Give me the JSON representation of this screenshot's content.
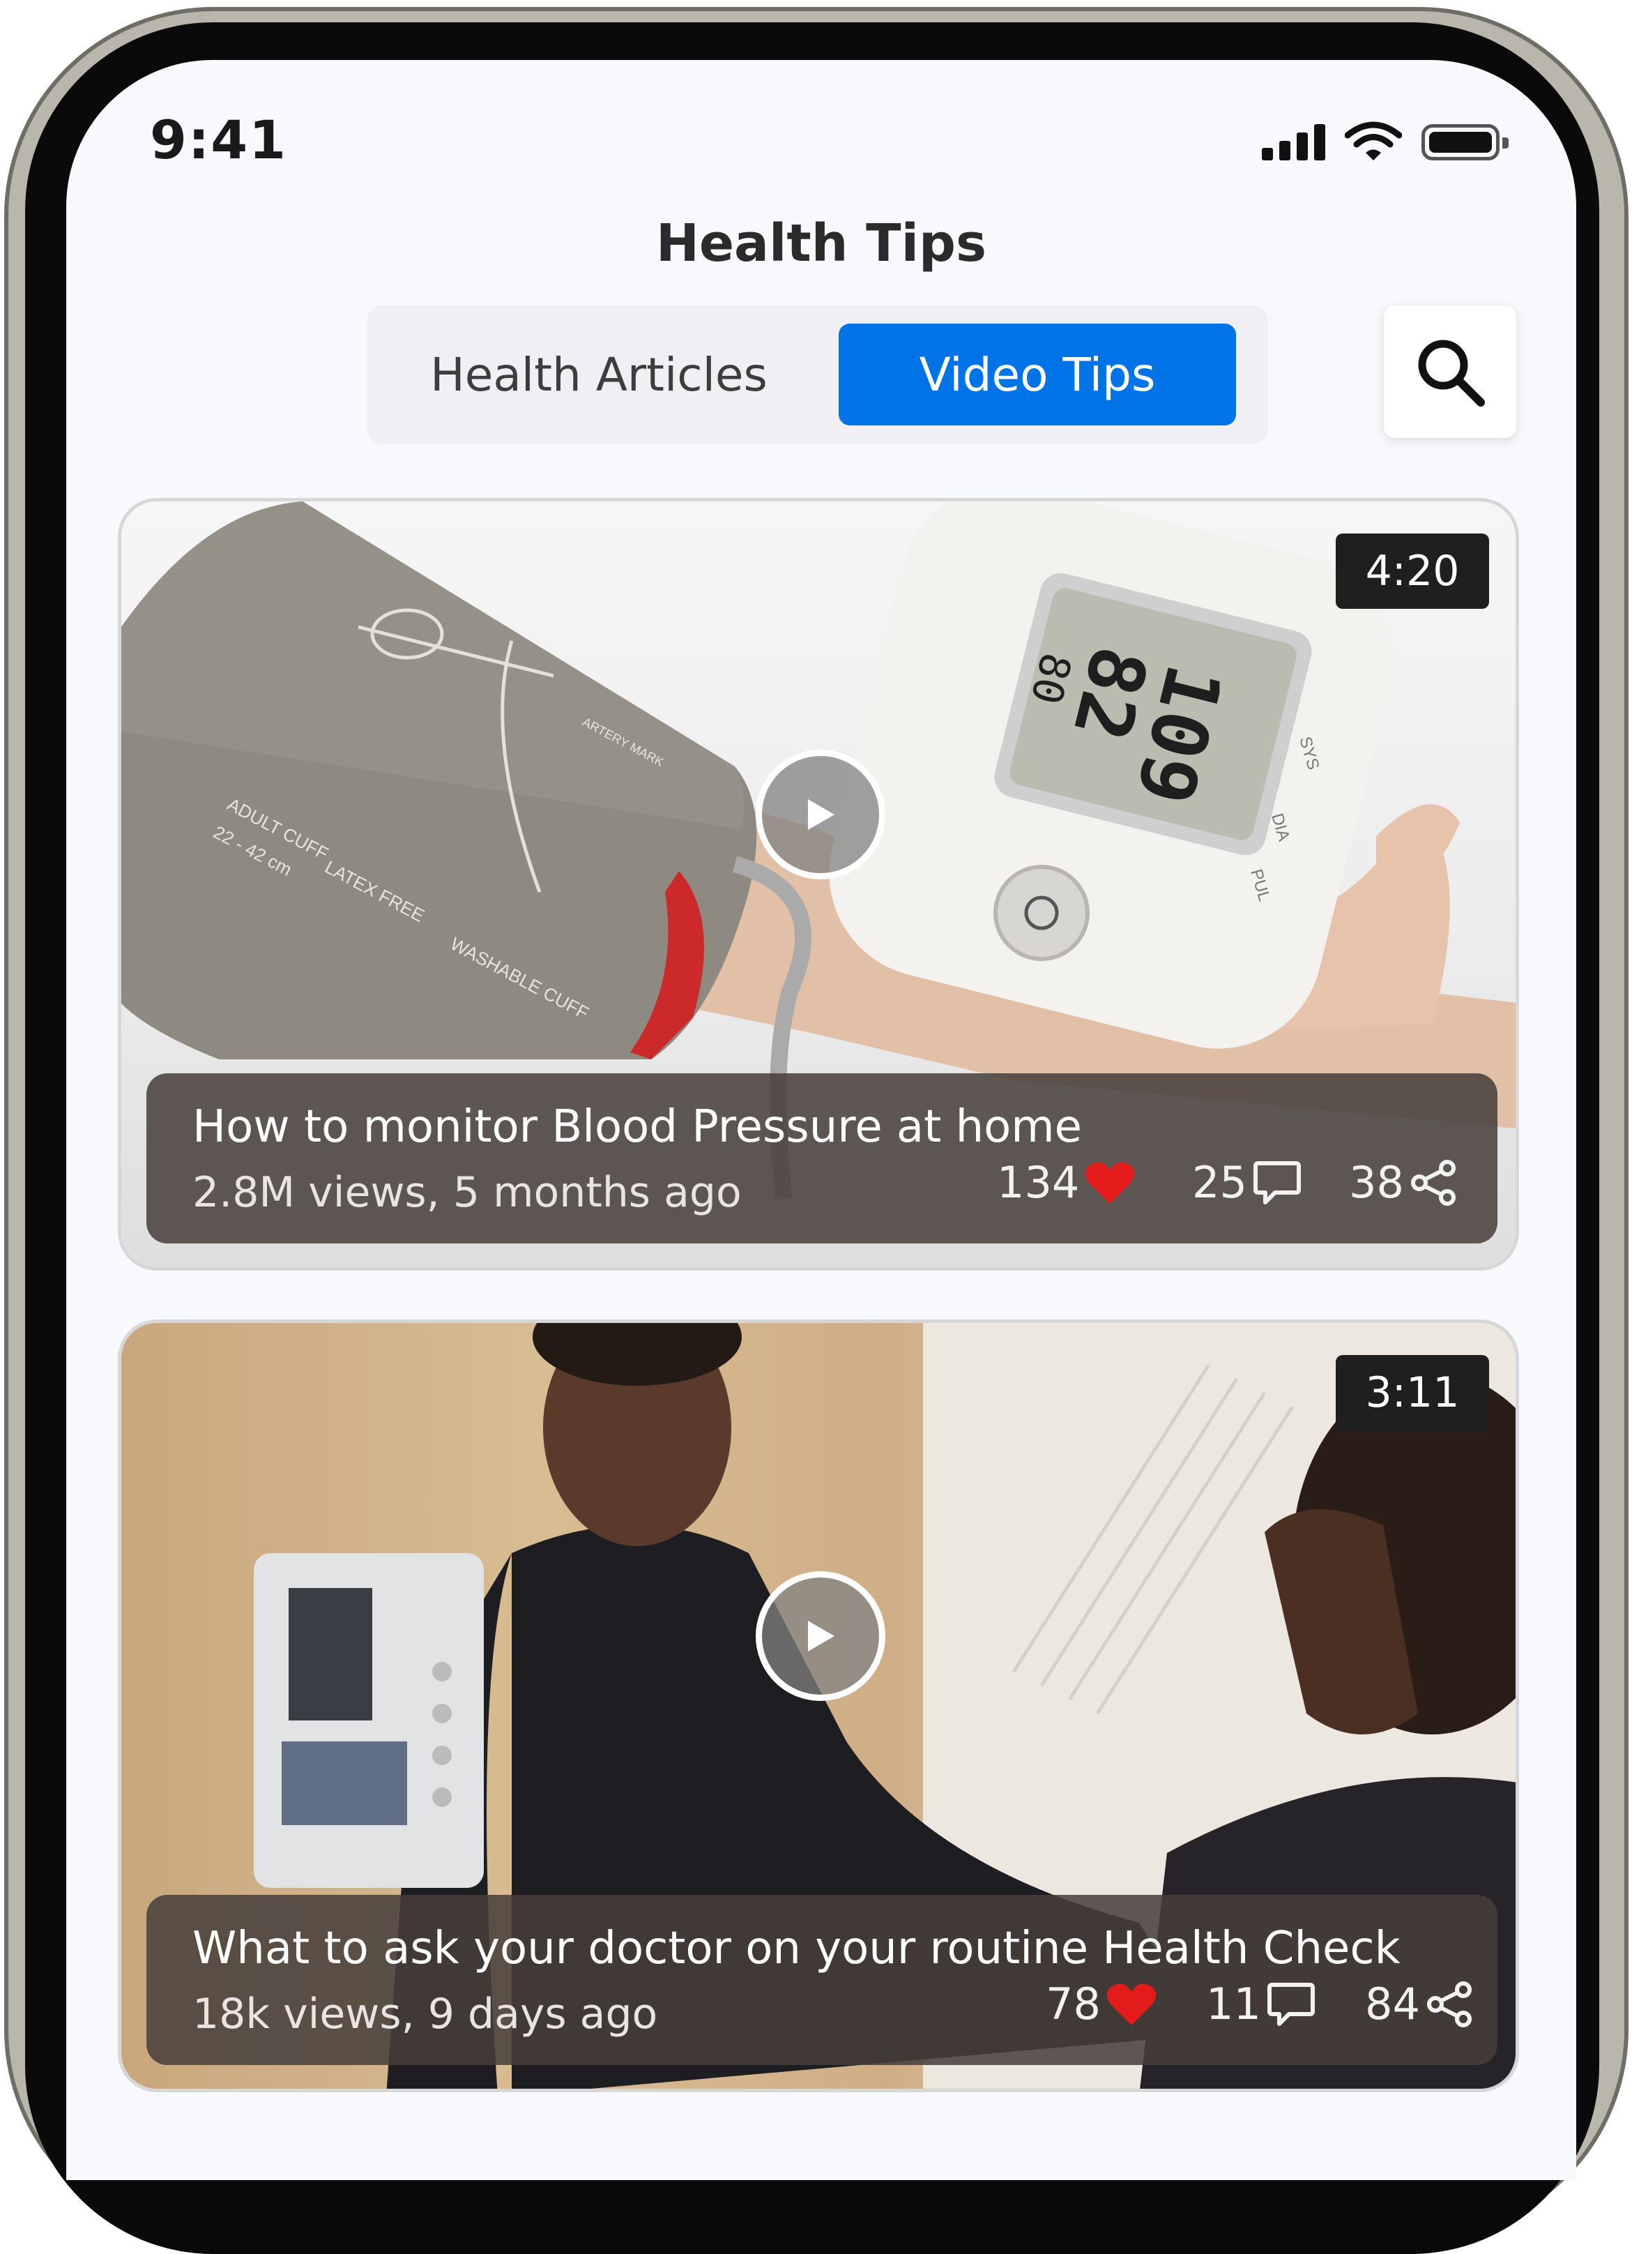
{
  "status_bar": {
    "time": "9:41"
  },
  "header": {
    "title": "Health Tips",
    "tabs": [
      {
        "label": "Health Articles",
        "selected": false
      },
      {
        "label": "Video Tips",
        "selected": true
      }
    ],
    "search_icon": "search-icon"
  },
  "colors": {
    "accent": "#0073e6",
    "heart": "#e41b1b"
  },
  "videos": [
    {
      "duration": "4:20",
      "title": "How to monitor Blood Pressure at home",
      "meta": "2.8M views, 5 months ago",
      "likes": "134",
      "comments": "25",
      "shares": "38",
      "monitor_readings": [
        "109",
        "82",
        "80"
      ],
      "monitor_labels": [
        "SYS",
        "DIA",
        "PUL"
      ],
      "cuff_labels": [
        "ADULT CUFF",
        "22 - 42 cm",
        "LATEX FREE",
        "WASHABLE CUFF",
        "ARTERY MARK"
      ]
    },
    {
      "duration": "3:11",
      "title": "What to ask your doctor on your routine Health Check",
      "meta": "18k views, 9 days ago",
      "likes": "78",
      "comments": "11",
      "shares": "84"
    }
  ]
}
